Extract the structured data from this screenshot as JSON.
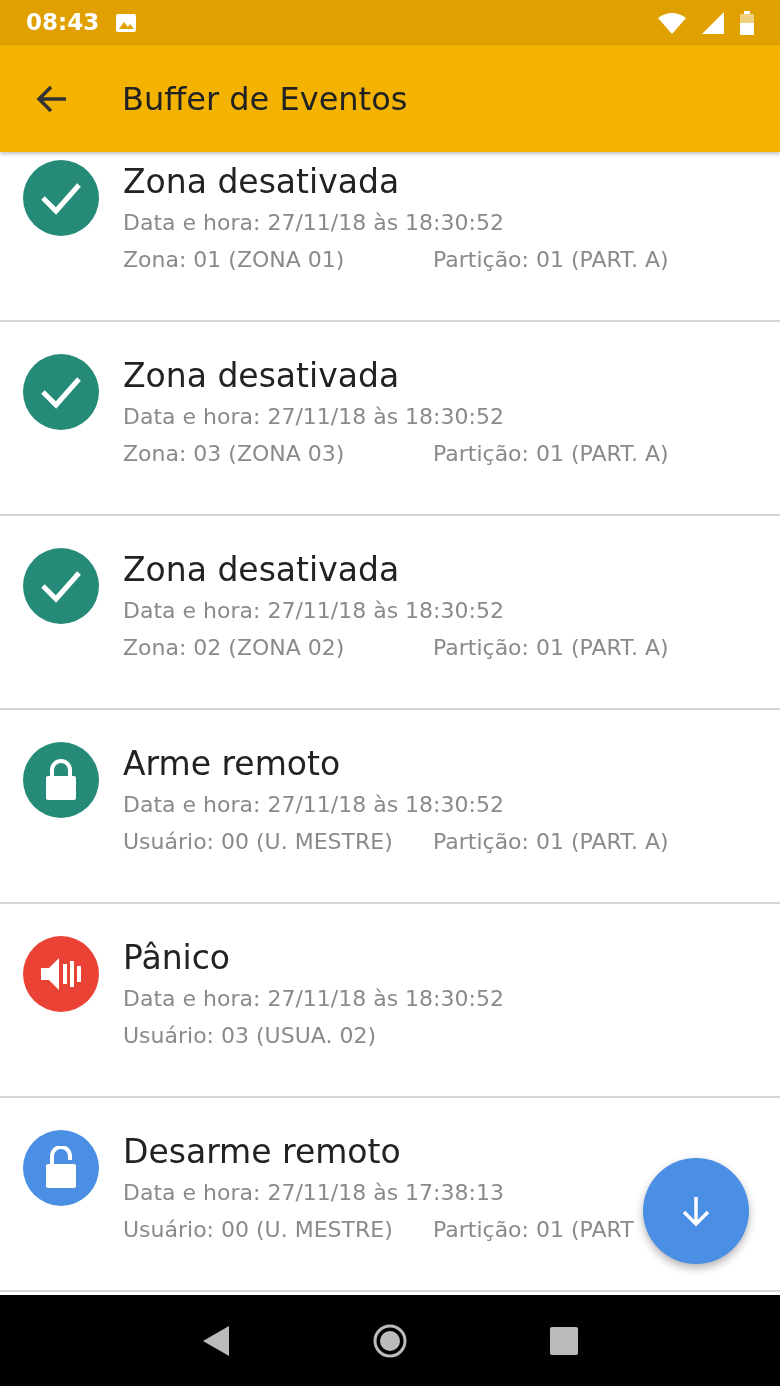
{
  "status_bar": {
    "time": "08:43"
  },
  "app_bar": {
    "title": "Buffer de Eventos"
  },
  "events": [
    {
      "title": "Zona desativada",
      "kind": "check",
      "color": "#268a78",
      "datetime": "Data e hora: 27/11/18 às 18:30:52",
      "details": [
        "Zona: 01 (ZONA 01)",
        "Partição: 01 (PART. A)"
      ]
    },
    {
      "title": "Zona desativada",
      "kind": "check",
      "color": "#268a78",
      "datetime": "Data e hora: 27/11/18 às 18:30:52",
      "details": [
        "Zona: 03 (ZONA 03)",
        "Partição: 01 (PART. A)"
      ]
    },
    {
      "title": "Zona desativada",
      "kind": "check",
      "color": "#268a78",
      "datetime": "Data e hora: 27/11/18 às 18:30:52",
      "details": [
        "Zona: 02 (ZONA 02)",
        "Partição: 01 (PART. A)"
      ]
    },
    {
      "title": "Arme remoto",
      "kind": "lock",
      "color": "#268a78",
      "datetime": "Data e hora: 27/11/18 às 18:30:52",
      "details": [
        "Usuário: 00 (U. MESTRE)",
        "Partição: 01 (PART. A)"
      ]
    },
    {
      "title": "Pânico",
      "kind": "siren",
      "color": "#ea4335",
      "datetime": "Data e hora: 27/11/18 às 18:30:52",
      "details": [
        "Usuário: 03 (USUA. 02)"
      ]
    },
    {
      "title": "Desarme remoto",
      "kind": "unlock",
      "color": "#4a8fe3",
      "datetime": "Data e hora: 27/11/18 às 17:38:13",
      "details": [
        "Usuário: 00 (U. MESTRE)",
        "Partição: 01 (PART"
      ]
    }
  ]
}
